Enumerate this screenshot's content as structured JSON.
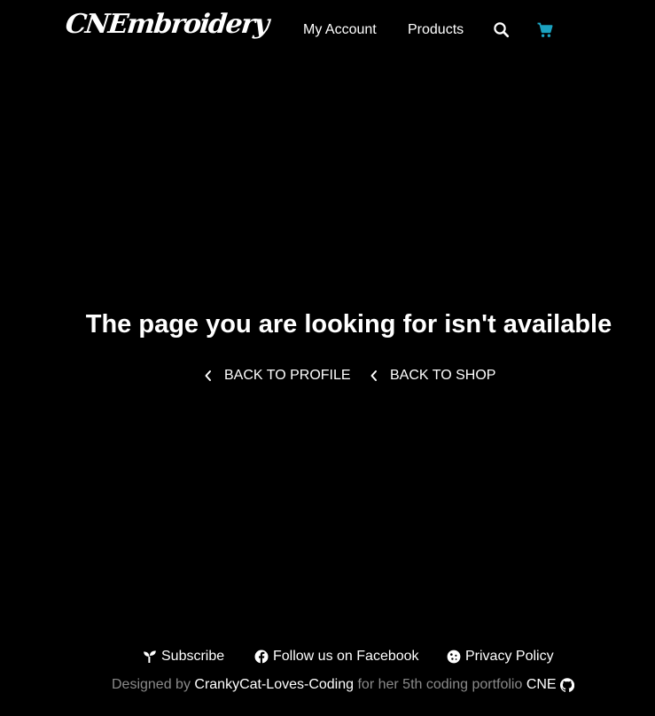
{
  "brand": {
    "logo_text": "CNEmbroidery"
  },
  "nav": {
    "account_label": "My Account",
    "products_label": "Products",
    "search_icon": "search-icon",
    "cart_icon": "shopping-cart-icon",
    "cart_color": "#1ba2c0"
  },
  "main": {
    "title": "The page you are looking for isn't available",
    "back_profile_label": "BACK TO PROFILE",
    "back_shop_label": "BACK TO SHOP"
  },
  "footer": {
    "subscribe_label": "Subscribe",
    "facebook_label": "Follow us on Facebook",
    "privacy_label": "Privacy Policy",
    "credit_prefix": "Designed by ",
    "credit_author": "CrankyCat-Loves-Coding",
    "credit_middle": " for her 5th coding portfolio ",
    "credit_project": "CNE",
    "github_icon": "github-icon"
  },
  "colors": {
    "background": "#000000",
    "text": "#ffffff",
    "muted_text": "#8a8a8a",
    "accent": "#1ba2c0"
  }
}
